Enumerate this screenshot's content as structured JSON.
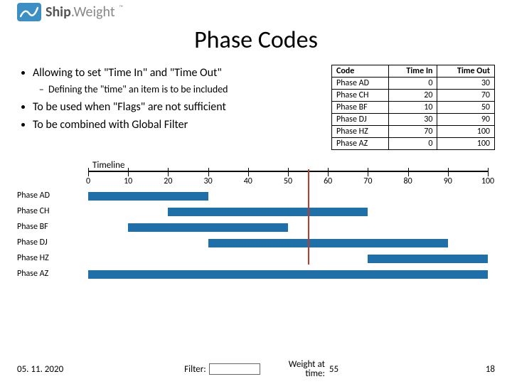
{
  "logo": {
    "brand_a": "Ship",
    "brand_b": ".Weight",
    "tm": "™"
  },
  "title": "Phase Codes",
  "bullets": [
    "Allowing to set \"Time In\" and \"Time Out\"",
    "To be used when \"Flags\" are not sufficient",
    "To be combined with Global Filter"
  ],
  "sub_bullet": "Defining the \"time\" an item is to be included",
  "table": {
    "headers": [
      "Code",
      "Time In",
      "Time Out"
    ],
    "rows": [
      {
        "code": "Phase AD",
        "in": 0,
        "out": 30
      },
      {
        "code": "Phase CH",
        "in": 20,
        "out": 70
      },
      {
        "code": "Phase BF",
        "in": 10,
        "out": 50
      },
      {
        "code": "Phase DJ",
        "in": 30,
        "out": 90
      },
      {
        "code": "Phase HZ",
        "in": 70,
        "out": 100
      },
      {
        "code": "Phase AZ",
        "in": 0,
        "out": 100
      }
    ]
  },
  "timeline": {
    "title": "Timeline",
    "min": 0,
    "max": 100,
    "ticks": [
      0,
      10,
      20,
      30,
      40,
      50,
      60,
      70,
      80,
      90,
      100
    ],
    "marker": 55
  },
  "footer": {
    "date": "05. 11. 2020",
    "filter_label": "Filter:",
    "weight_label_a": "Weight at",
    "weight_label_b": "time:",
    "weight_value": 55,
    "page": 18
  },
  "chart_data": {
    "type": "bar",
    "title": "Timeline",
    "xlabel": "",
    "ylabel": "",
    "xlim": [
      0,
      100
    ],
    "orientation": "horizontal",
    "categories": [
      "Phase AD",
      "Phase CH",
      "Phase BF",
      "Phase DJ",
      "Phase HZ",
      "Phase AZ"
    ],
    "series": [
      {
        "name": "Time In",
        "values": [
          0,
          20,
          10,
          30,
          70,
          0
        ]
      },
      {
        "name": "Time Out",
        "values": [
          30,
          70,
          50,
          90,
          100,
          100
        ]
      }
    ],
    "annotations": [
      {
        "type": "vline",
        "x": 55,
        "label": "Weight at time"
      }
    ]
  }
}
